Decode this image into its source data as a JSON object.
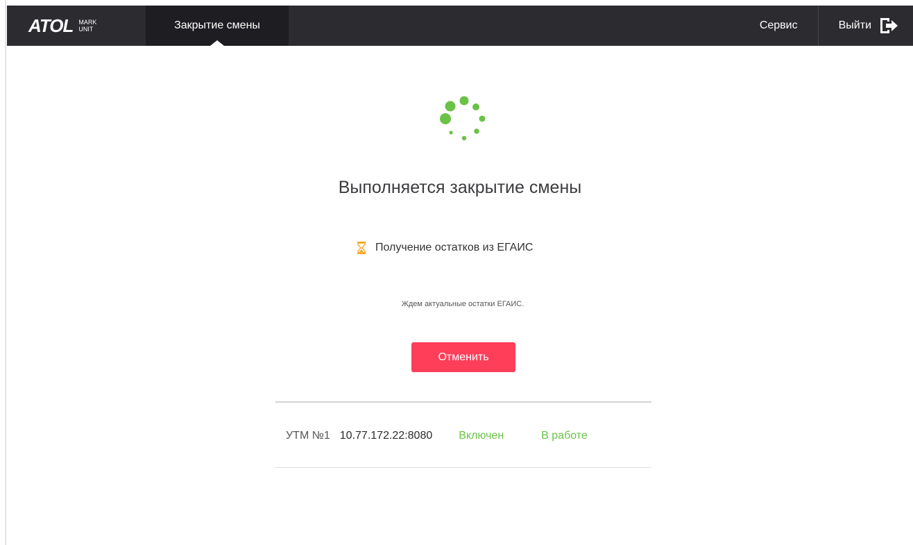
{
  "header": {
    "logo_main": "ATOL",
    "logo_sub_top": "MARK",
    "logo_sub_bottom": "UNIT",
    "active_tab": "Закрытие смены",
    "service_label": "Сервис",
    "logout_label": "Выйти"
  },
  "main": {
    "title": "Выполняется закрытие смены",
    "step_text": "Получение остатков из ЕГАИС",
    "note": "Ждем актуальные остатки ЕГАИС.",
    "cancel_label": "Отменить"
  },
  "utm": {
    "label": "УТМ №1",
    "address": "10.77.172.22:8080",
    "state": "Включен",
    "work_status": "В работе"
  },
  "colors": {
    "accent_green": "#6ac246",
    "cancel_red": "#ff3e5a",
    "header_bg": "#2b2b30",
    "hourglass": "#f5a623"
  },
  "icons": {
    "spinner": "loading-spinner-icon",
    "step": "hourglass-icon",
    "logout": "logout-arrow-icon"
  }
}
